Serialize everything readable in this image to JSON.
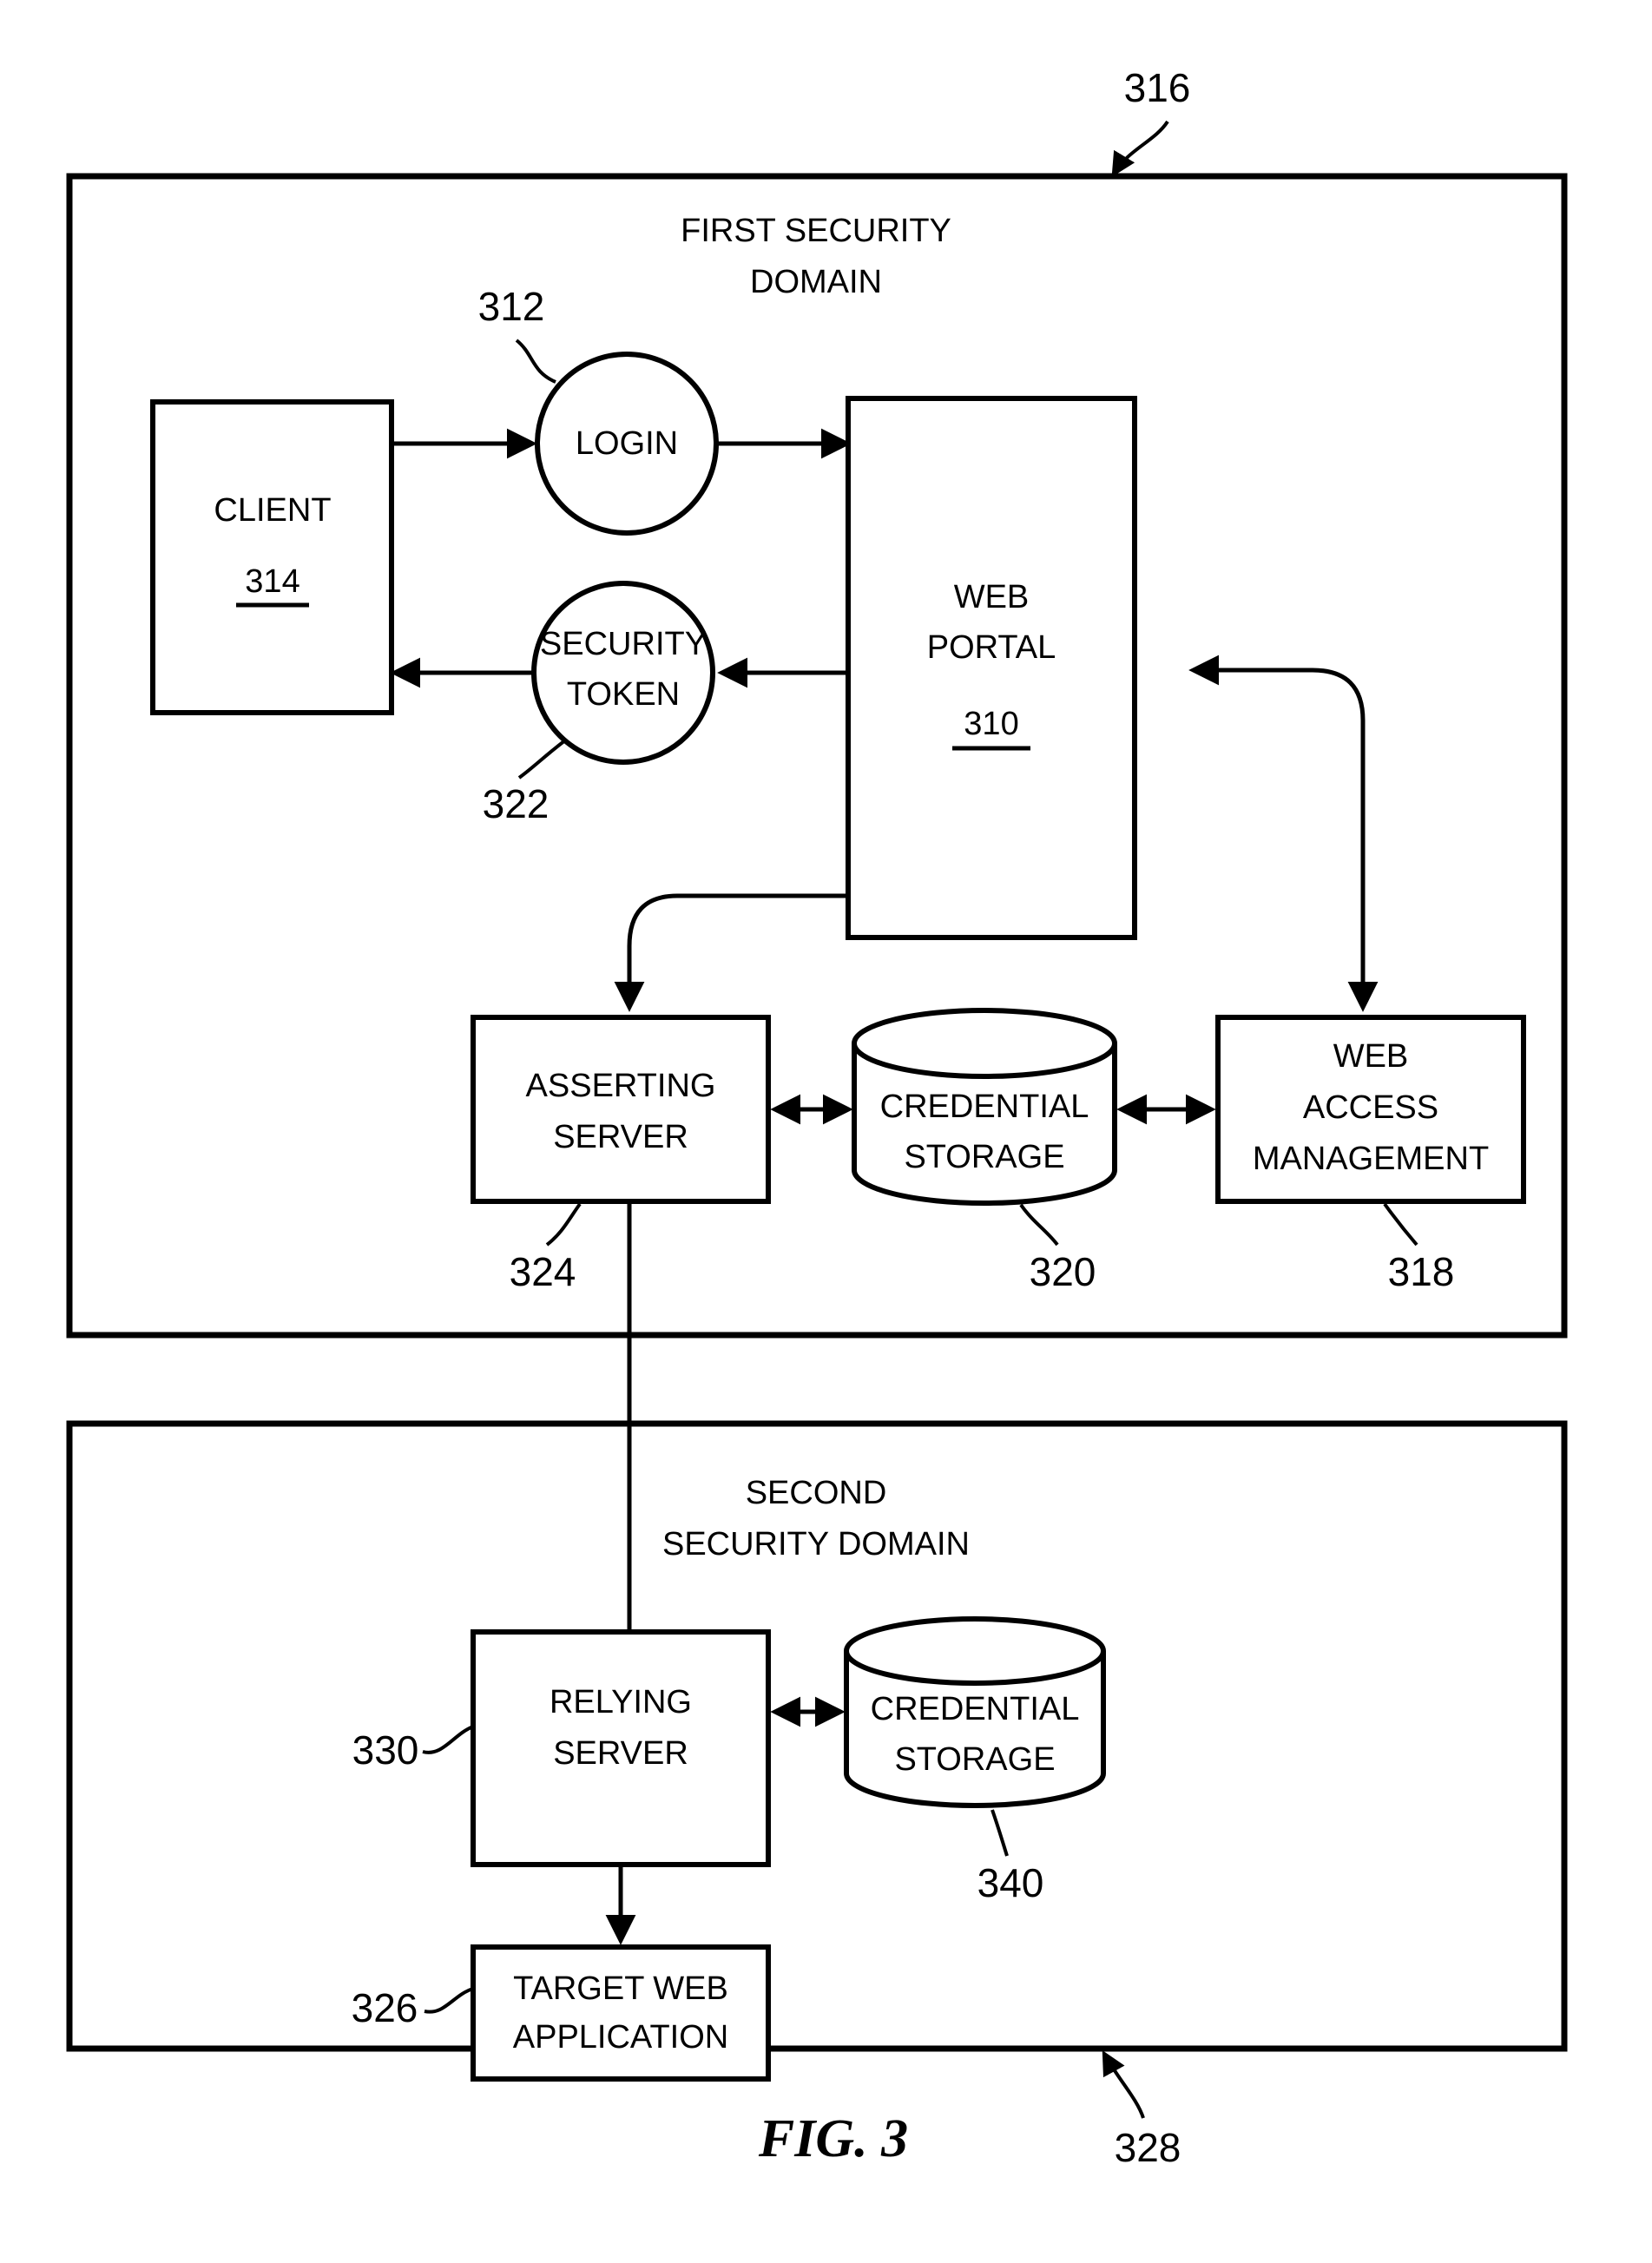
{
  "figure": {
    "caption": "FIG. 3",
    "top_ref": "316",
    "bottom_ref": "328"
  },
  "domains": {
    "first": {
      "title_line1": "FIRST SECURITY",
      "title_line2": "DOMAIN",
      "ref": "316"
    },
    "second": {
      "title_line1": "SECOND",
      "title_line2": "SECURITY DOMAIN",
      "ref": "328"
    }
  },
  "nodes": {
    "client": {
      "label": "CLIENT",
      "ref": "314"
    },
    "login": {
      "label": "LOGIN",
      "ref": "312"
    },
    "security_token": {
      "label_line1": "SECURITY",
      "label_line2": "TOKEN",
      "ref": "322"
    },
    "web_portal": {
      "label_line1": "WEB",
      "label_line2": "PORTAL",
      "ref": "310"
    },
    "asserting_server": {
      "label_line1": "ASSERTING",
      "label_line2": "SERVER",
      "ref": "324"
    },
    "credential_storage_first": {
      "label_line1": "CREDENTIAL",
      "label_line2": "STORAGE",
      "ref": "320"
    },
    "web_access_management": {
      "label_line1": "WEB",
      "label_line2": "ACCESS",
      "label_line3": "MANAGEMENT",
      "ref": "318"
    },
    "relying_server": {
      "label_line1": "RELYING",
      "label_line2": "SERVER",
      "ref": "330"
    },
    "credential_storage_second": {
      "label_line1": "CREDENTIAL",
      "label_line2": "STORAGE",
      "ref": "340"
    },
    "target_web_application": {
      "label_line1": "TARGET WEB",
      "label_line2": "APPLICATION",
      "ref": "326"
    }
  },
  "colors": {
    "ink": "#000000",
    "paper": "#ffffff"
  }
}
